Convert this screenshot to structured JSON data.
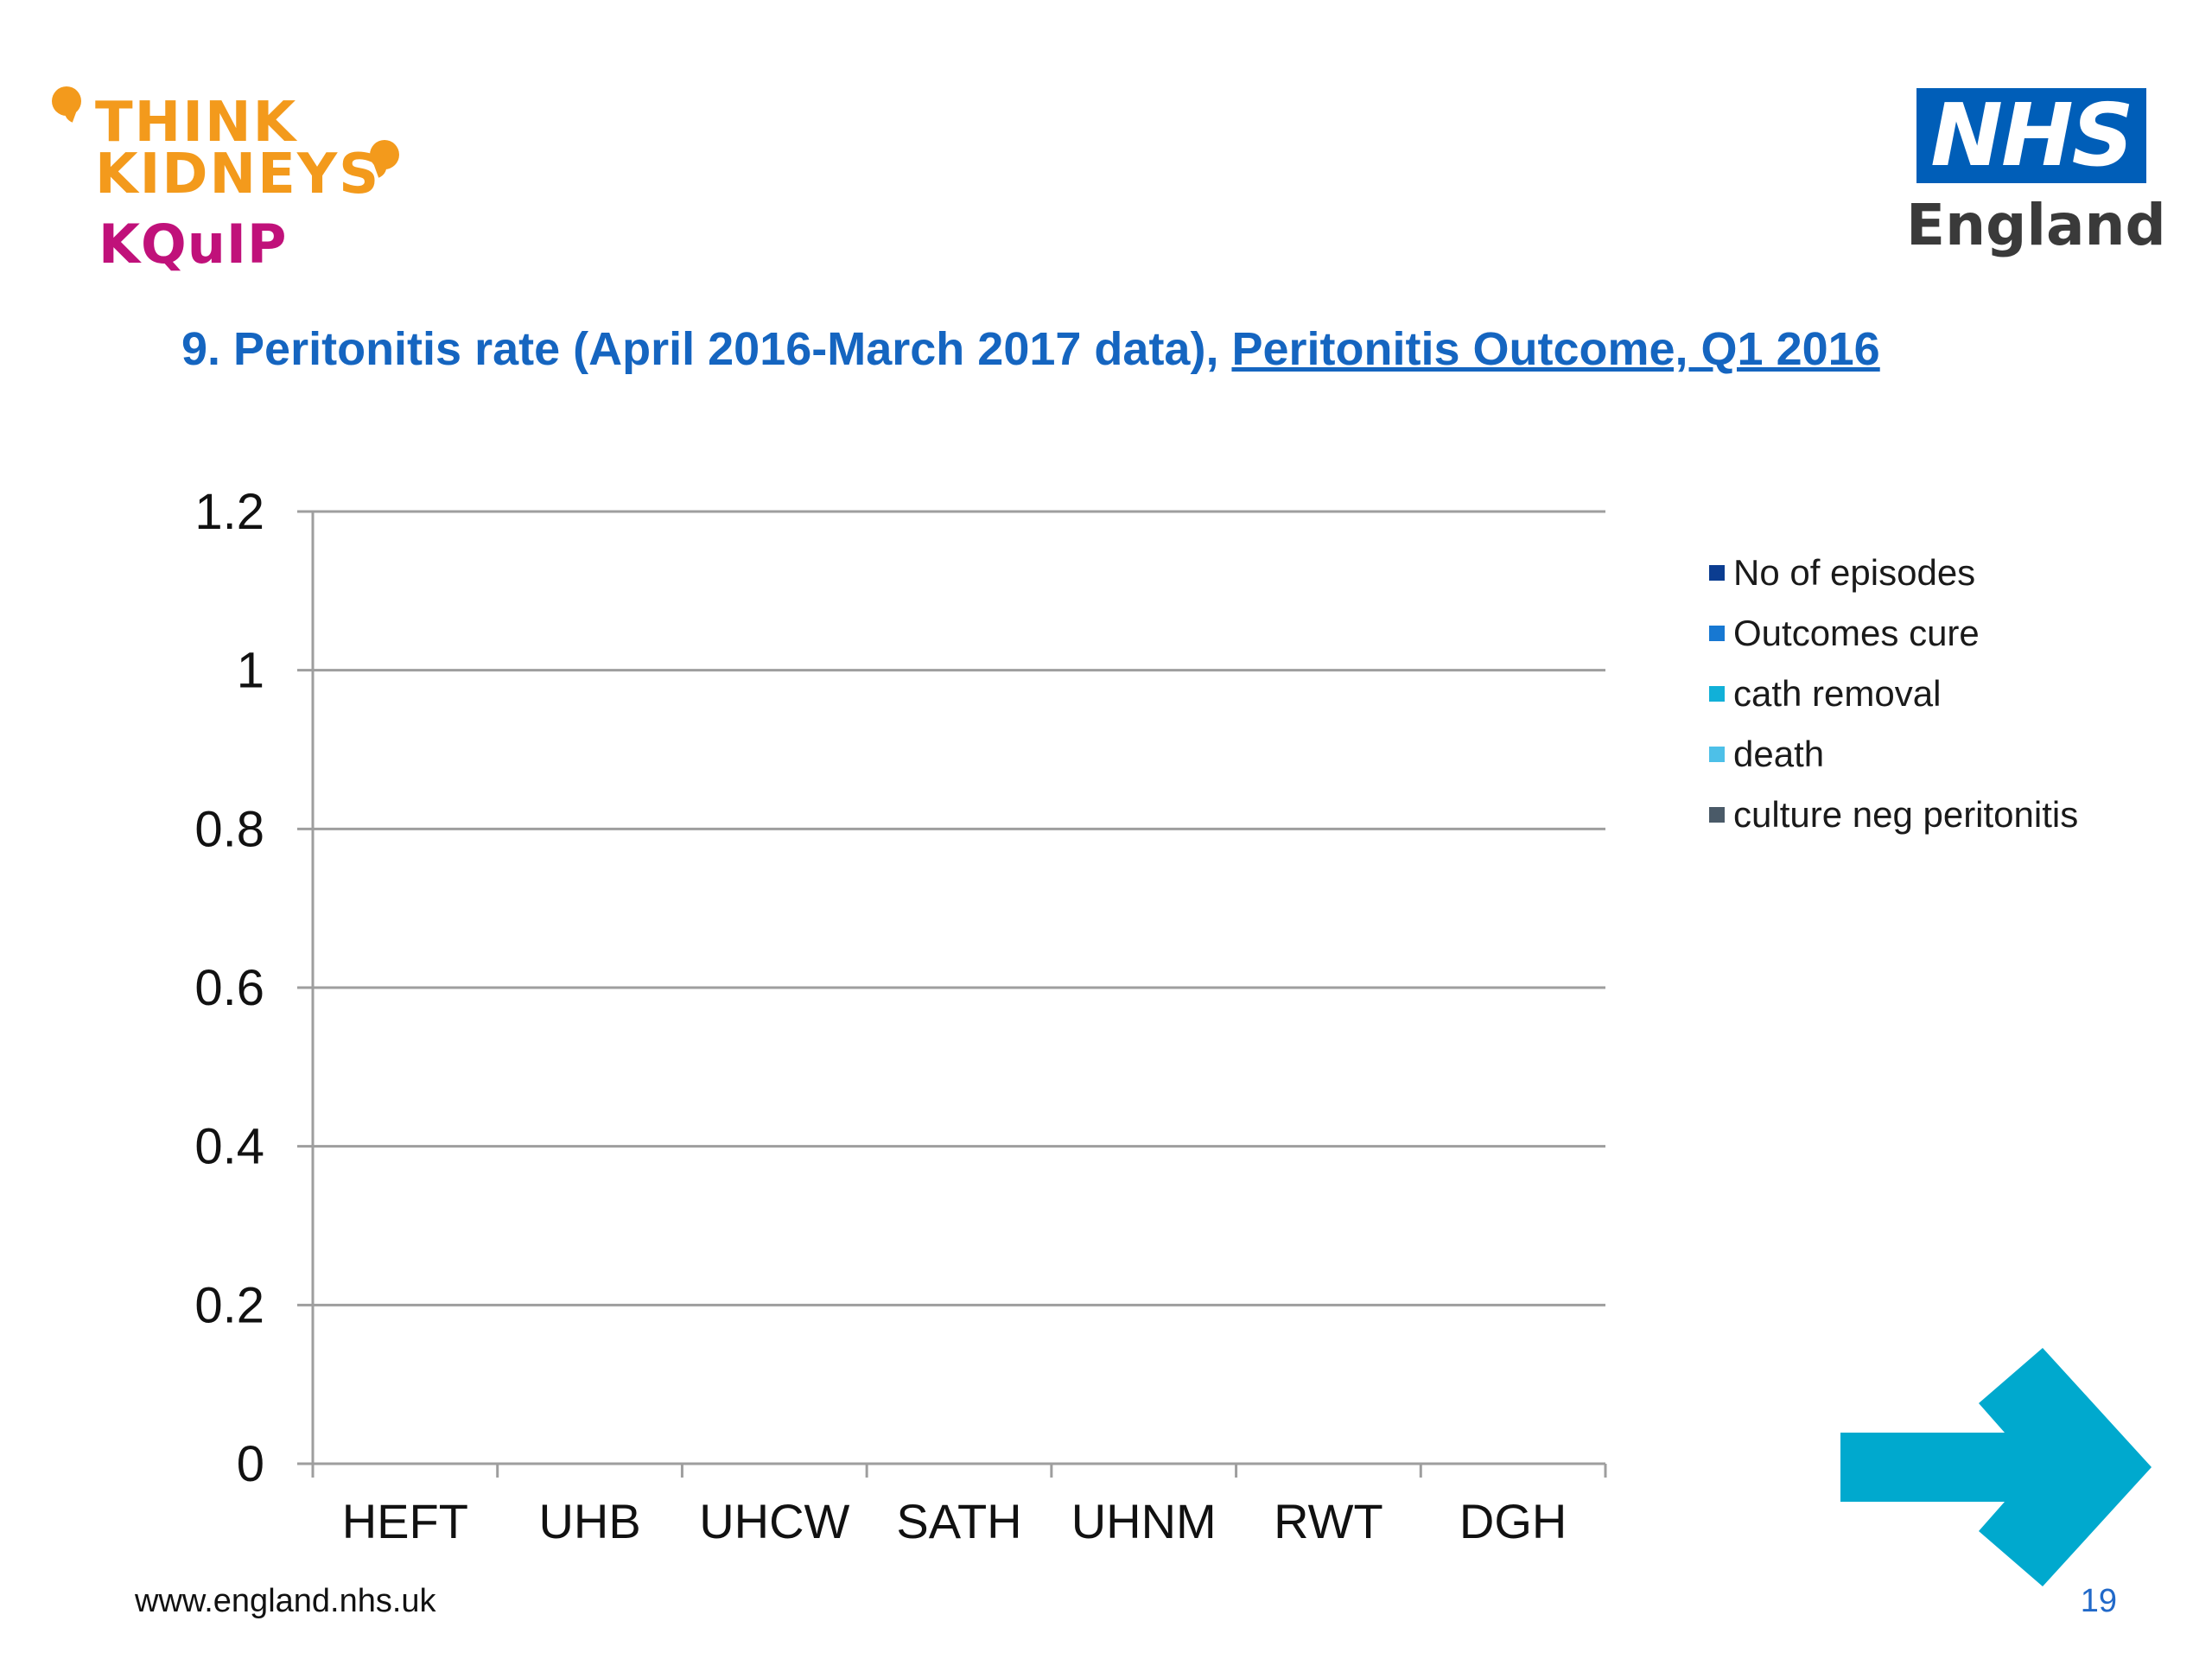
{
  "branding": {
    "kquip_line1": "THINK",
    "kquip_line2": "KIDNEYS",
    "kquip_line3": "KQuIP",
    "nhs_mark": "NHS",
    "nhs_region": "England"
  },
  "colors": {
    "think_orange": "#f39a1c",
    "kquip_magenta": "#c0117a",
    "nhs_blue": "#005eb8",
    "title_blue": "#1565c0",
    "arrow_teal": "#00a9ce",
    "axis_gray": "#9e9e9e",
    "page_number_blue": "#2169c9"
  },
  "title": {
    "text": "9. Peritonitis rate (April 2016-March 2017 data), ",
    "link": "Peritonitis Outcome, Q1 2016"
  },
  "chart_data": {
    "type": "bar",
    "categories": [
      "HEFT",
      "UHB",
      "UHCW",
      "SATH",
      "UHNM",
      "RWT",
      "DGH"
    ],
    "series": [
      {
        "name": "No of episodes",
        "color": "#0b3d91",
        "values": []
      },
      {
        "name": "Outcomes cure",
        "color": "#1778d2",
        "values": []
      },
      {
        "name": "cath removal",
        "color": "#11b0d8",
        "values": []
      },
      {
        "name": "death",
        "color": "#4dc0e8",
        "values": []
      },
      {
        "name": "culture neg peritonitis",
        "color": "#4a5a68",
        "values": []
      }
    ],
    "ylim": [
      0,
      1.2
    ],
    "yticks": [
      "0",
      "0.2",
      "0.4",
      "0.6",
      "0.8",
      "1",
      "1.2"
    ],
    "grid": true,
    "legend": "right"
  },
  "footer": {
    "url": "www.england.nhs.uk",
    "page_number": "19"
  },
  "navigation": {
    "next_icon": "arrow-right-icon"
  }
}
